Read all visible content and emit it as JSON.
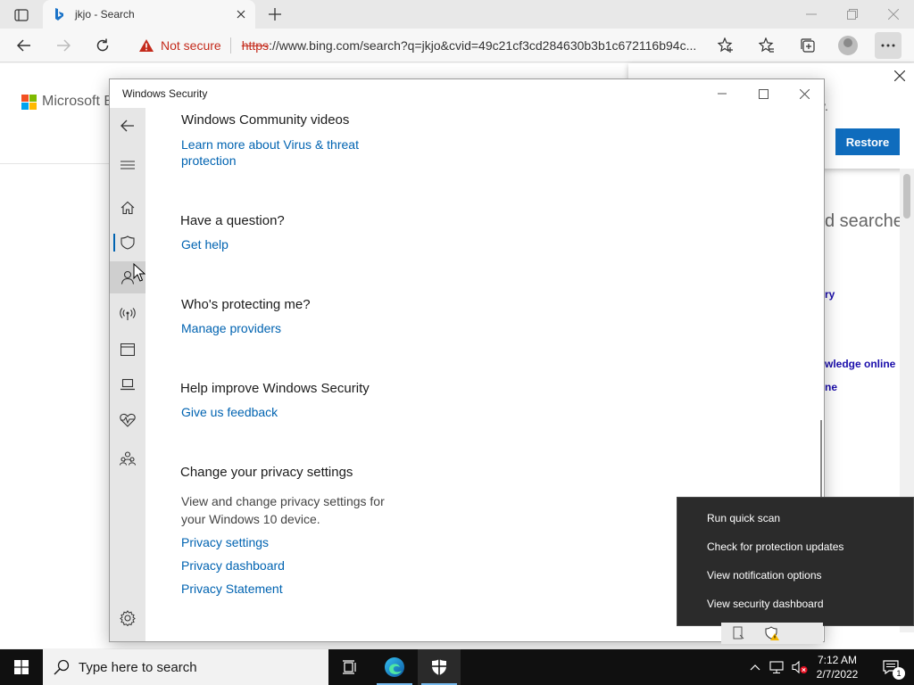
{
  "browser": {
    "tab_title": "jkjo - Search",
    "security_label": "Not secure",
    "url_protocol": "https",
    "url_rest": "://www.bing.com/search?q=jkjo&cvid=49c21cf3cd284630b3b1c672116b94c..."
  },
  "page_behind": {
    "logo_text": "Microsoft Bi",
    "restore_button": "Restore",
    "fragments": [
      "y.",
      "d searche",
      "ry",
      "wledge online",
      "ne"
    ]
  },
  "ws": {
    "title": "Windows Security",
    "sections": [
      {
        "heading": "Windows Community videos",
        "link": "Learn more about Virus & threat protection"
      },
      {
        "heading": "Have a question?",
        "link": "Get help"
      },
      {
        "heading": "Who's protecting me?",
        "link": "Manage providers"
      },
      {
        "heading": "Help improve Windows Security",
        "link": "Give us feedback"
      },
      {
        "heading": "Change your privacy settings",
        "description": "View and change privacy settings for your Windows 10 device.",
        "links": [
          "Privacy settings",
          "Privacy dashboard",
          "Privacy Statement"
        ]
      }
    ]
  },
  "context_menu": {
    "items": [
      "Run quick scan",
      "Check for protection updates",
      "View notification options",
      "View security dashboard"
    ]
  },
  "taskbar": {
    "search_placeholder": "Type here to search",
    "time": "7:12 AM",
    "date": "2/7/2022",
    "notification_count": "1"
  },
  "colors": {
    "accent": "#0063b1",
    "warning": "#c42b1c",
    "restore": "#0f6cbd"
  }
}
